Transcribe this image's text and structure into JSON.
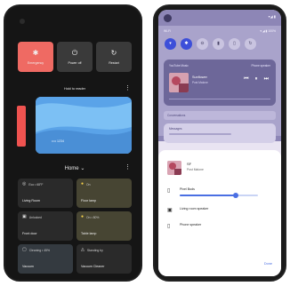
{
  "left_phone": {
    "power_menu": [
      {
        "icon": "sos-icon",
        "glyph": "✱",
        "label": "Emergency",
        "active": true
      },
      {
        "icon": "power-off-icon",
        "glyph": "⏻",
        "label": "Power off",
        "active": false
      },
      {
        "icon": "restart-icon",
        "glyph": "↻",
        "label": "Restart",
        "active": false
      }
    ],
    "wallet": {
      "title": "Hold to reader",
      "more_glyph": "⋮",
      "card_label": "•••• 1234"
    },
    "home": {
      "title": "Home",
      "chevron": "⌄",
      "more_glyph": "⋮"
    },
    "controls": [
      {
        "icon": "thermostat-icon",
        "glyph": "◎",
        "status": "Eco • 68°F",
        "name": "Living Room",
        "tone": "dark",
        "yellow": false
      },
      {
        "icon": "bulb-icon",
        "glyph": "●",
        "status": "On",
        "name": "Floor lamp",
        "tone": "warm",
        "yellow": true
      },
      {
        "icon": "lock-icon",
        "glyph": "▣",
        "status": "Unlocked",
        "name": "Front door",
        "tone": "dark",
        "yellow": false
      },
      {
        "icon": "bulb-icon",
        "glyph": "●",
        "status": "On • 80%",
        "name": "Table lamp",
        "tone": "warm",
        "yellow": true
      },
      {
        "icon": "vacuum-icon",
        "glyph": "▢",
        "status": "Cleaning • 45%",
        "name": "Vacuum",
        "tone": "slate",
        "yellow": false
      },
      {
        "icon": "speaker-icon",
        "glyph": "◬",
        "status": "Standing by",
        "name": "Vacuum Cleaner",
        "tone": "dark",
        "yellow": false
      }
    ]
  },
  "right_phone": {
    "status_time": "▾◢ ▮",
    "carrier": "Wi-Fi",
    "status_icons": "▾ ◢ ▮ 100%",
    "quick_settings": [
      {
        "icon": "wifi-icon",
        "glyph": "▾",
        "on": true
      },
      {
        "icon": "bluetooth-icon",
        "glyph": "✱",
        "on": true
      },
      {
        "icon": "dnd-icon",
        "glyph": "⊖",
        "on": false
      },
      {
        "icon": "flashlight-icon",
        "glyph": "▮",
        "on": false
      },
      {
        "icon": "battery-saver-icon",
        "glyph": "▯",
        "on": false
      },
      {
        "icon": "rotate-icon",
        "glyph": "↻",
        "on": false
      }
    ],
    "media": {
      "app": "YouTube Music",
      "output": "Phone speaker",
      "title": "Sunflower",
      "artist": "Post Malone",
      "prev_glyph": "⏮",
      "pause_glyph": "⏸",
      "next_glyph": "⏭"
    },
    "conversation_header": "Conversations",
    "message_app": "Messages",
    "sheet": {
      "title": "SF",
      "artist": "Post Malone",
      "done_label": "Done",
      "devices": [
        {
          "icon": "phone-icon",
          "glyph": "▯",
          "name": "Pixel Buds",
          "volume": 0.72,
          "slider": true
        },
        {
          "icon": "speaker-icon",
          "glyph": "▣",
          "name": "Living room speaker",
          "slider": false
        },
        {
          "icon": "phone-icon",
          "glyph": "▯",
          "name": "Phone speaker",
          "slider": false
        }
      ]
    }
  },
  "colors": {
    "accent_red": "#ef5350",
    "accent_blue": "#4a6fe3",
    "shade_purple": "#8d86b6"
  }
}
